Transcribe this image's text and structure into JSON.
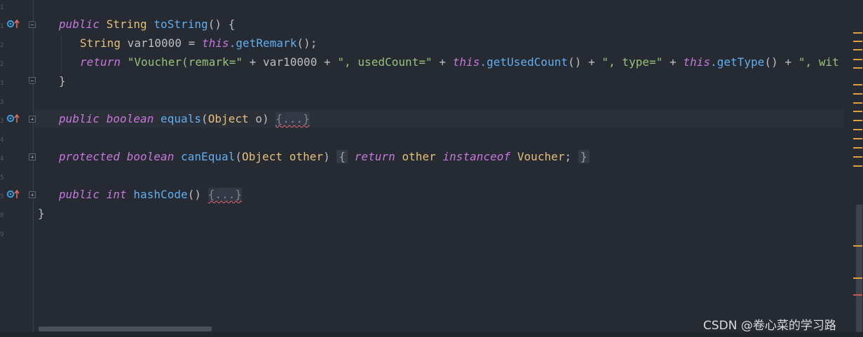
{
  "editor": {
    "lines": {
      "tostring_sig": {
        "kw": "public",
        "type": "String",
        "name": "toString",
        "rest": "() {"
      },
      "var_decl": {
        "type": "String",
        "pre": " var10000 = ",
        "this": "this",
        "call": ".getRemark",
        "rest": "();"
      },
      "return_line": {
        "ret": "return",
        "s1": "\"Voucher(remark=\"",
        "p1": " + var10000 + ",
        "s2": "\", usedCount=\"",
        "p2": " + ",
        "this1": "this",
        "c1": ".getUsedCount",
        "p3": "() + ",
        "s3": "\", type=\"",
        "p4": " + ",
        "this2": "this",
        "c2": ".getType",
        "p5": "() + ",
        "s4": "\", wit"
      },
      "close_brace": "}",
      "equals_sig": {
        "kw1": "public",
        "kw2": "boolean",
        "name": "equals",
        "open": "(",
        "ptype": "Object",
        "pname": " o) ",
        "folded": "{...}"
      },
      "canequal_sig": {
        "kw1": "protected",
        "kw2": "boolean",
        "name": "canEqual",
        "open": "(",
        "ptype": "Object",
        "pname": "other",
        "close": ") ",
        "brace_open": "{",
        "ret": "return",
        "var": "other",
        "kw3": "instanceof",
        "cls": "Voucher",
        "semi": ";",
        "brace_close": "}"
      },
      "hashcode_sig": {
        "kw1": "public",
        "kw2": "int",
        "name": "hashCode",
        "rest": "() ",
        "folded": "{...}"
      },
      "class_close": "}"
    },
    "gutter_icons": [
      "override-icon",
      "override-icon",
      "override-icon"
    ]
  },
  "watermark": "CSDN @卷心菜的学习路",
  "colors": {
    "background": "#262a33",
    "keyword": "#c678dd",
    "type": "#e5c07b",
    "function": "#61afef",
    "string": "#98c379",
    "scroll_marker": "#e0a039",
    "error_marker": "#c7544f"
  }
}
